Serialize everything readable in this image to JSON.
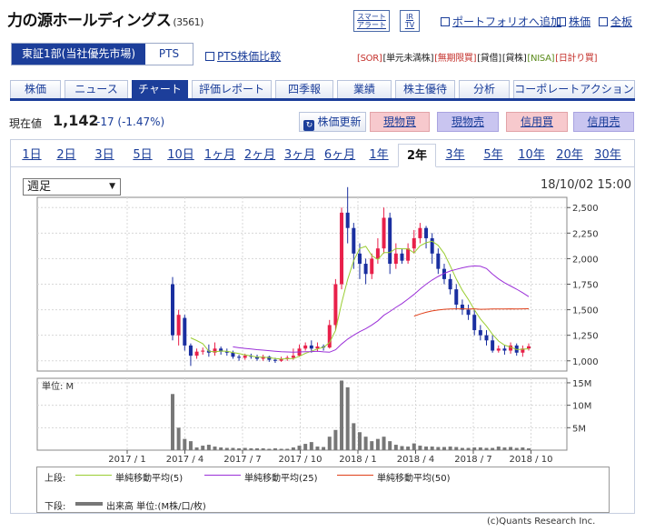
{
  "header": {
    "company_name": "力の源ホールディングス",
    "code": "(3561)",
    "smart_alert": [
      "スマート",
      "アラート"
    ],
    "ir_tv": [
      "IR",
      "TV"
    ],
    "links": [
      "ポートフォリオへ追加",
      "株価",
      "全板"
    ]
  },
  "market_tabs": [
    "東証1部(当社優先市場)",
    "PTS"
  ],
  "pts_compare": "PTS株価比較",
  "tags": [
    "[SOR]",
    "[単元未満株]",
    "[無期限買]",
    "[貸借]",
    "[貸株]",
    "[NISA]",
    "[日計り買]"
  ],
  "main_tabs": [
    "株価",
    "ニュース",
    "チャート",
    "評価レポート",
    "四季報",
    "業績",
    "株主優待",
    "分析",
    "コーポレートアクション"
  ],
  "active_main_tab": "チャート",
  "price": {
    "label": "現在値",
    "value": "1,142",
    "change": "-17 (-1.47%)"
  },
  "action_buttons": {
    "update": "株価更新",
    "cash_buy": "現物買",
    "cash_sell": "現物売",
    "margin_buy": "信用買",
    "margin_sell": "信用売"
  },
  "period_tabs": [
    "1日",
    "2日",
    "3日",
    "5日",
    "10日",
    "1ヶ月",
    "2ヶ月",
    "3ヶ月",
    "6ヶ月",
    "1年",
    "2年",
    "3年",
    "5年",
    "10年",
    "20年",
    "30年"
  ],
  "active_period": "2年",
  "period_select": "週足",
  "timestamp": "18/10/02 15:00",
  "colors": {
    "up": "#e8204a",
    "down": "#1a2fa0",
    "ma5": "#9acd32",
    "ma25": "#9b30d8",
    "ma50": "#e0401a",
    "volume": "#777777",
    "accent": "#1c3e9a"
  },
  "chart_data": {
    "type": "candlestick",
    "price_ticks": [
      "2,500",
      "2,250",
      "2,000",
      "1,750",
      "1,500",
      "1,250",
      "1,000"
    ],
    "price_range": [
      900,
      2600
    ],
    "volume_label": "単位: M",
    "volume_ticks": [
      "15M",
      "10M",
      "5M"
    ],
    "volume_range": [
      0,
      16
    ],
    "x_ticks": [
      "2017 / 1",
      "2017 / 4",
      "2017 / 7",
      "2017 / 10",
      "2018 / 1",
      "2018 / 4",
      "2018 / 7",
      "2018 / 10"
    ],
    "candles": [
      [
        1750,
        1250,
        1820,
        1200,
        12.5
      ],
      [
        1250,
        1450,
        1500,
        1150,
        5.0
      ],
      [
        1420,
        1150,
        1450,
        1100,
        2.5
      ],
      [
        1150,
        1050,
        1170,
        950,
        2.0
      ],
      [
        1050,
        1090,
        1120,
        1020,
        0.6
      ],
      [
        1090,
        1100,
        1130,
        1060,
        1.0
      ],
      [
        1100,
        1080,
        1160,
        1040,
        1.2
      ],
      [
        1080,
        1120,
        1180,
        1050,
        0.8
      ],
      [
        1120,
        1090,
        1140,
        1060,
        0.6
      ],
      [
        1090,
        1080,
        1120,
        1050,
        0.5
      ],
      [
        1080,
        1040,
        1100,
        1020,
        0.5
      ],
      [
        1040,
        1030,
        1060,
        1000,
        0.4
      ],
      [
        1030,
        1050,
        1070,
        1010,
        0.5
      ],
      [
        1050,
        1040,
        1070,
        1020,
        0.4
      ],
      [
        1040,
        1020,
        1060,
        1000,
        0.4
      ],
      [
        1020,
        1040,
        1060,
        1000,
        0.4
      ],
      [
        1040,
        1010,
        1050,
        990,
        0.3
      ],
      [
        1010,
        1000,
        1030,
        980,
        0.4
      ],
      [
        1000,
        1020,
        1040,
        990,
        0.3
      ],
      [
        1020,
        1030,
        1050,
        1000,
        0.3
      ],
      [
        1030,
        1050,
        1120,
        1010,
        0.6
      ],
      [
        1050,
        1120,
        1160,
        1040,
        1.0
      ],
      [
        1120,
        1150,
        1180,
        1100,
        1.4
      ],
      [
        1150,
        1120,
        1200,
        1080,
        1.8
      ],
      [
        1120,
        1140,
        1180,
        1090,
        0.8
      ],
      [
        1140,
        1130,
        1160,
        1100,
        0.7
      ],
      [
        1130,
        1350,
        1400,
        1120,
        3.0
      ],
      [
        1350,
        1750,
        1800,
        1300,
        4.5
      ],
      [
        1750,
        2450,
        2500,
        1700,
        15.5
      ],
      [
        2450,
        2300,
        2700,
        2150,
        14.0
      ],
      [
        2300,
        2050,
        2350,
        1900,
        6.0
      ],
      [
        2050,
        1950,
        2150,
        1800,
        4.0
      ],
      [
        1950,
        1850,
        2000,
        1750,
        3.0
      ],
      [
        1850,
        2000,
        2050,
        1800,
        2.0
      ],
      [
        2000,
        2100,
        2200,
        1950,
        2.5
      ],
      [
        2100,
        2400,
        2500,
        2050,
        3.0
      ],
      [
        2400,
        1950,
        2450,
        1850,
        2.0
      ],
      [
        1950,
        2050,
        2150,
        1900,
        1.2
      ],
      [
        2050,
        1980,
        2100,
        1950,
        0.9
      ],
      [
        1980,
        2100,
        2150,
        1950,
        0.8
      ],
      [
        2100,
        2200,
        2280,
        2050,
        1.5
      ],
      [
        2200,
        2300,
        2350,
        2150,
        1.0
      ],
      [
        2300,
        2200,
        2320,
        2100,
        0.8
      ],
      [
        2200,
        2050,
        2250,
        1950,
        0.8
      ],
      [
        2050,
        1900,
        2100,
        1850,
        0.7
      ],
      [
        1900,
        1800,
        1950,
        1750,
        0.7
      ],
      [
        1800,
        1700,
        1850,
        1650,
        0.8
      ],
      [
        1700,
        1550,
        1750,
        1500,
        0.7
      ],
      [
        1550,
        1500,
        1600,
        1450,
        0.5
      ],
      [
        1500,
        1450,
        1550,
        1400,
        0.5
      ],
      [
        1450,
        1300,
        1500,
        1250,
        0.6
      ],
      [
        1300,
        1250,
        1350,
        1200,
        0.6
      ],
      [
        1250,
        1200,
        1300,
        1150,
        0.5
      ],
      [
        1200,
        1100,
        1250,
        1080,
        0.5
      ],
      [
        1100,
        1120,
        1150,
        1080,
        0.8
      ],
      [
        1120,
        1100,
        1150,
        1060,
        0.6
      ],
      [
        1100,
        1150,
        1180,
        1070,
        0.7
      ],
      [
        1150,
        1080,
        1170,
        1050,
        0.5
      ],
      [
        1080,
        1120,
        1150,
        1040,
        0.6
      ],
      [
        1120,
        1142,
        1170,
        1100,
        0.4
      ]
    ]
  },
  "legend": {
    "upper_label": "上段:",
    "lower_label": "下段:",
    "ma5": "単純移動平均(5)",
    "ma25": "単純移動平均(25)",
    "ma50": "単純移動平均(50)",
    "volume": "出来高 単位:(M株/口/枚)"
  },
  "copyright": "(c)Quants Research Inc."
}
